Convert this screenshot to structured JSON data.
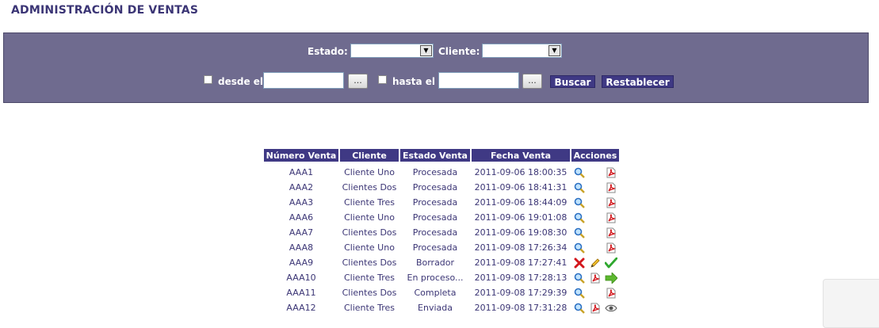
{
  "header": {
    "title": "ADMINISTRACIÓN DE VENTAS"
  },
  "filters": {
    "estado_label": "Estado:",
    "cliente_label": "Cliente:",
    "desde_label": "desde el",
    "hasta_label": "hasta el",
    "date_button_label": "...",
    "buscar_label": "Buscar",
    "restablecer_label": "Restablecer"
  },
  "table": {
    "columns": [
      "Número Venta",
      "Cliente",
      "Estado Venta",
      "Fecha Venta",
      "Acciones"
    ],
    "rows": [
      {
        "numero": "AAA1",
        "cliente": "Cliente Uno",
        "estado": "Procesada",
        "fecha": "2011-09-06 18:00:35",
        "actions": [
          "search-icon",
          "",
          "pdf-icon"
        ]
      },
      {
        "numero": "AAA2",
        "cliente": "Clientes Dos",
        "estado": "Procesada",
        "fecha": "2011-09-06 18:41:31",
        "actions": [
          "search-icon",
          "",
          "pdf-icon"
        ]
      },
      {
        "numero": "AAA3",
        "cliente": "Cliente Tres",
        "estado": "Procesada",
        "fecha": "2011-09-06 18:44:09",
        "actions": [
          "search-icon",
          "",
          "pdf-icon"
        ]
      },
      {
        "numero": "AAA6",
        "cliente": "Cliente Uno",
        "estado": "Procesada",
        "fecha": "2011-09-06 19:01:08",
        "actions": [
          "search-icon",
          "",
          "pdf-icon"
        ]
      },
      {
        "numero": "AAA7",
        "cliente": "Clientes Dos",
        "estado": "Procesada",
        "fecha": "2011-09-06 19:08:30",
        "actions": [
          "search-icon",
          "",
          "pdf-icon"
        ]
      },
      {
        "numero": "AAA8",
        "cliente": "Cliente Uno",
        "estado": "Procesada",
        "fecha": "2011-09-08 17:26:34",
        "actions": [
          "search-icon",
          "",
          "pdf-icon"
        ]
      },
      {
        "numero": "AAA9",
        "cliente": "Clientes Dos",
        "estado": "Borrador",
        "fecha": "2011-09-08 17:27:41",
        "actions": [
          "delete-icon",
          "edit-icon",
          "approve-icon"
        ]
      },
      {
        "numero": "AAA10",
        "cliente": "Cliente Tres",
        "estado": "En proceso...",
        "fecha": "2011-09-08 17:28:13",
        "actions": [
          "search-icon",
          "pdf-icon",
          "forward-icon"
        ]
      },
      {
        "numero": "AAA11",
        "cliente": "Clientes Dos",
        "estado": "Completa",
        "fecha": "2011-09-08 17:29:39",
        "actions": [
          "search-icon",
          "",
          "pdf-icon"
        ]
      },
      {
        "numero": "AAA12",
        "cliente": "Cliente Tres",
        "estado": "Enviada",
        "fecha": "2011-09-08 17:31:28",
        "actions": [
          "search-icon",
          "pdf-icon",
          "view-icon"
        ]
      }
    ]
  },
  "colors": {
    "panel": "#6f6b8f",
    "header_bg": "#3f3984",
    "text": "#3b3575"
  }
}
